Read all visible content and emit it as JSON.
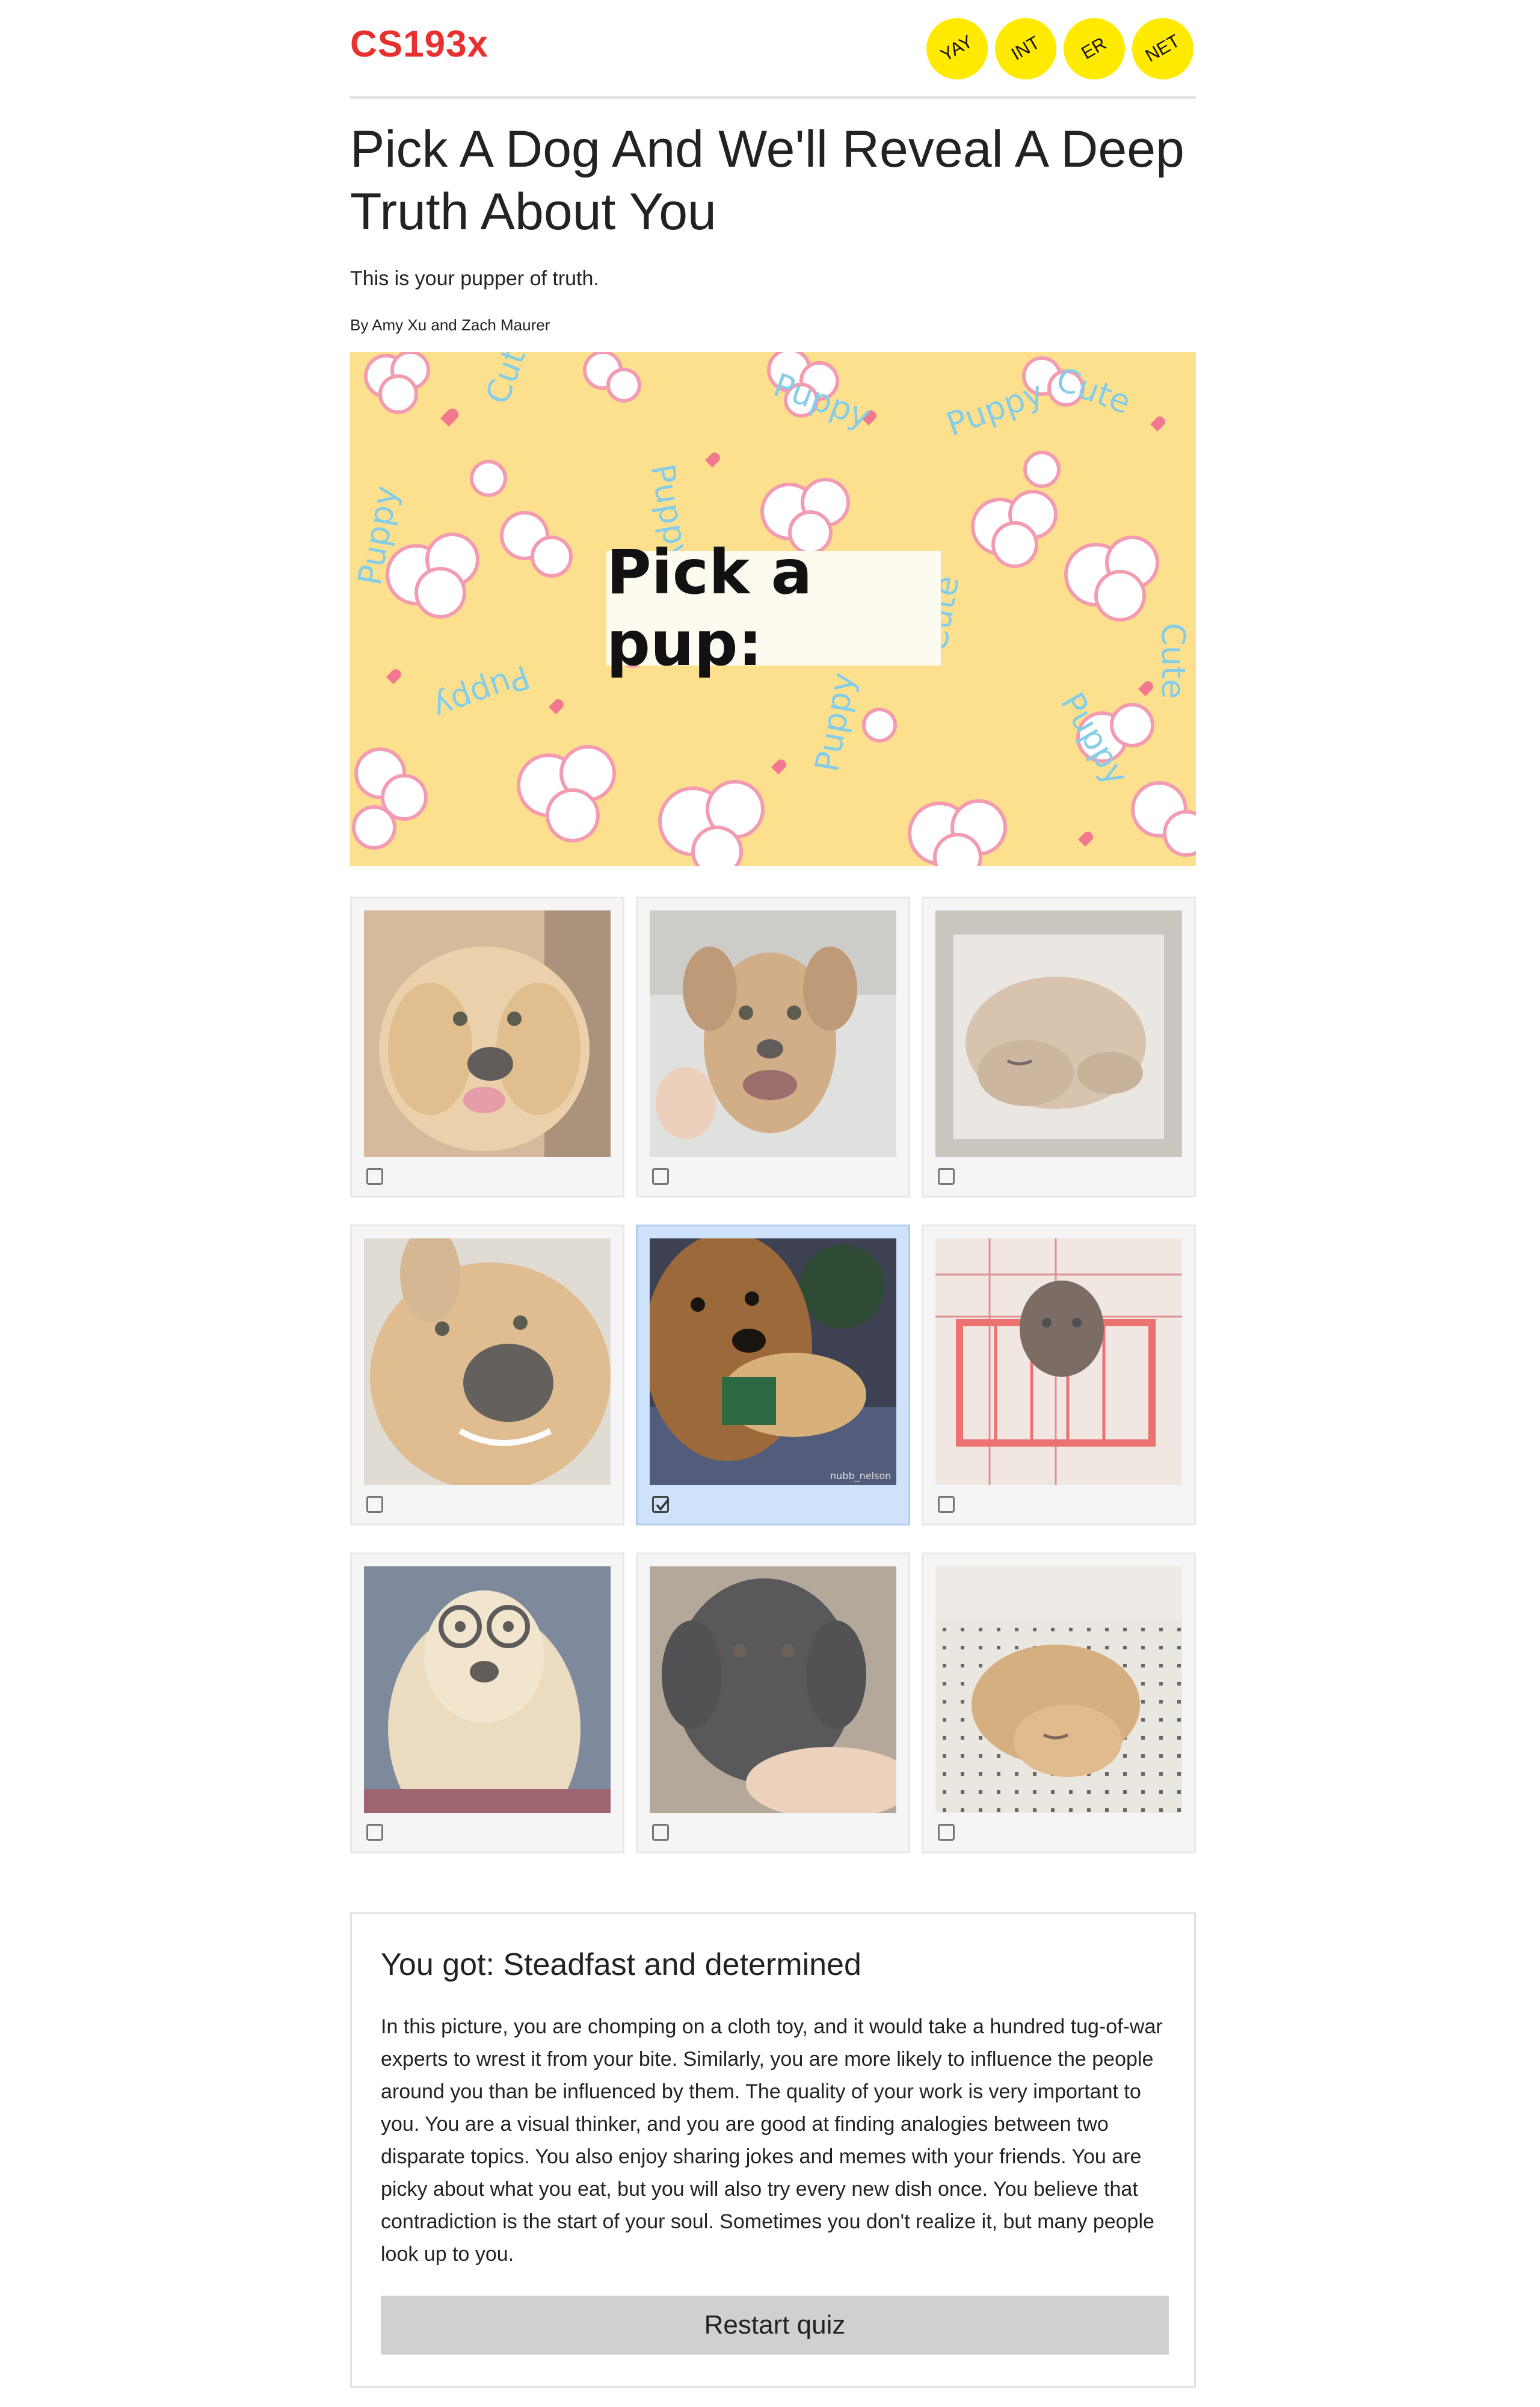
{
  "header": {
    "logo": "CS193x",
    "badges": [
      "YAY",
      "INT",
      "ER",
      "NET"
    ]
  },
  "article": {
    "title": "Pick A Dog And We'll Reveal A Deep Truth About You",
    "subtitle": "This is your pupper of truth.",
    "byline": "By Amy Xu and Zach Maurer"
  },
  "hero": {
    "label": "Pick a pup:",
    "pattern_words": [
      "Cute",
      "Puppy"
    ]
  },
  "choices": [
    {
      "name": "golden-puppy-tongue",
      "selected": false
    },
    {
      "name": "tan-dog-smiling-in-sink",
      "selected": false
    },
    {
      "name": "sleeping-puppy-in-tub",
      "selected": false
    },
    {
      "name": "golden-dog-close-up",
      "selected": false
    },
    {
      "name": "golden-retriever-chomping-toy",
      "selected": true
    },
    {
      "name": "poodle-in-shopping-cart",
      "selected": false
    },
    {
      "name": "golden-retriever-with-glasses",
      "selected": false
    },
    {
      "name": "black-lab-puppy-biting-hand",
      "selected": false
    },
    {
      "name": "golden-puppy-lying-on-tile",
      "selected": false
    }
  ],
  "result": {
    "heading": "You got: Steadfast and determined",
    "text": "In this picture, you are chomping on a cloth toy, and it would take a hundred tug-of-war experts to wrest it from your bite. Similarly, you are more likely to influence the people around you than be influenced by them. The quality of your work is very important to you. You are a visual thinker, and you are good at finding analogies between two disparate topics. You also enjoy sharing jokes and memes with your friends. You are picky about what you eat, but you will also try every new dish once. You believe that contradiction is the start of your soul. Sometimes you don't realize it, but many people look up to you.",
    "restart_label": "Restart quiz"
  },
  "colors": {
    "logo": "#e8312f",
    "badge": "#ffea00",
    "hero_bg": "#fde08d",
    "selected_card": "#cfe2fb",
    "button": "#d0d0d0"
  }
}
